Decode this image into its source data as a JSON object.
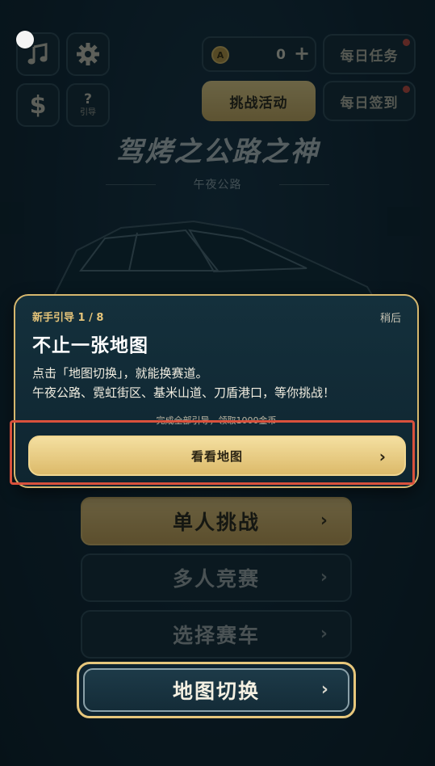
{
  "top_left_buttons": {
    "music_icon": "music-note-icon",
    "settings_icon": "gear-icon",
    "shop_icon": "dollar-icon",
    "guide": {
      "symbol": "?",
      "label": "引导"
    }
  },
  "currency": {
    "coin_letter": "A",
    "amount": "0",
    "plus": "+"
  },
  "top_right_buttons": {
    "daily_tasks": "每日任务",
    "daily_checkin": "每日签到",
    "challenge": "挑战活动"
  },
  "title": "驾烤之公路之神",
  "subtitle": "午夜公路",
  "guide_popup": {
    "step": "新手引导 1 / 8",
    "later": "稍后",
    "heading": "不止一张地图",
    "body_line1": "点击「地图切换」，就能换赛道。",
    "body_line2": "午夜公路、霓虹街区、基米山道、刀盾港口，等你挑战！",
    "reward": "完成全部引导，领取1000金币",
    "cta": "看看地图",
    "cta_chevron": "›"
  },
  "menu": {
    "single": "单人挑战",
    "multi": "多人竞赛",
    "car_select": "选择赛车",
    "map_switch": "地图切换",
    "chevron": "›"
  },
  "colors": {
    "gold": "#e6c57a",
    "panel": "#142833",
    "highlight_frame": "#d9513c",
    "notification_dot": "#c74a3c"
  }
}
